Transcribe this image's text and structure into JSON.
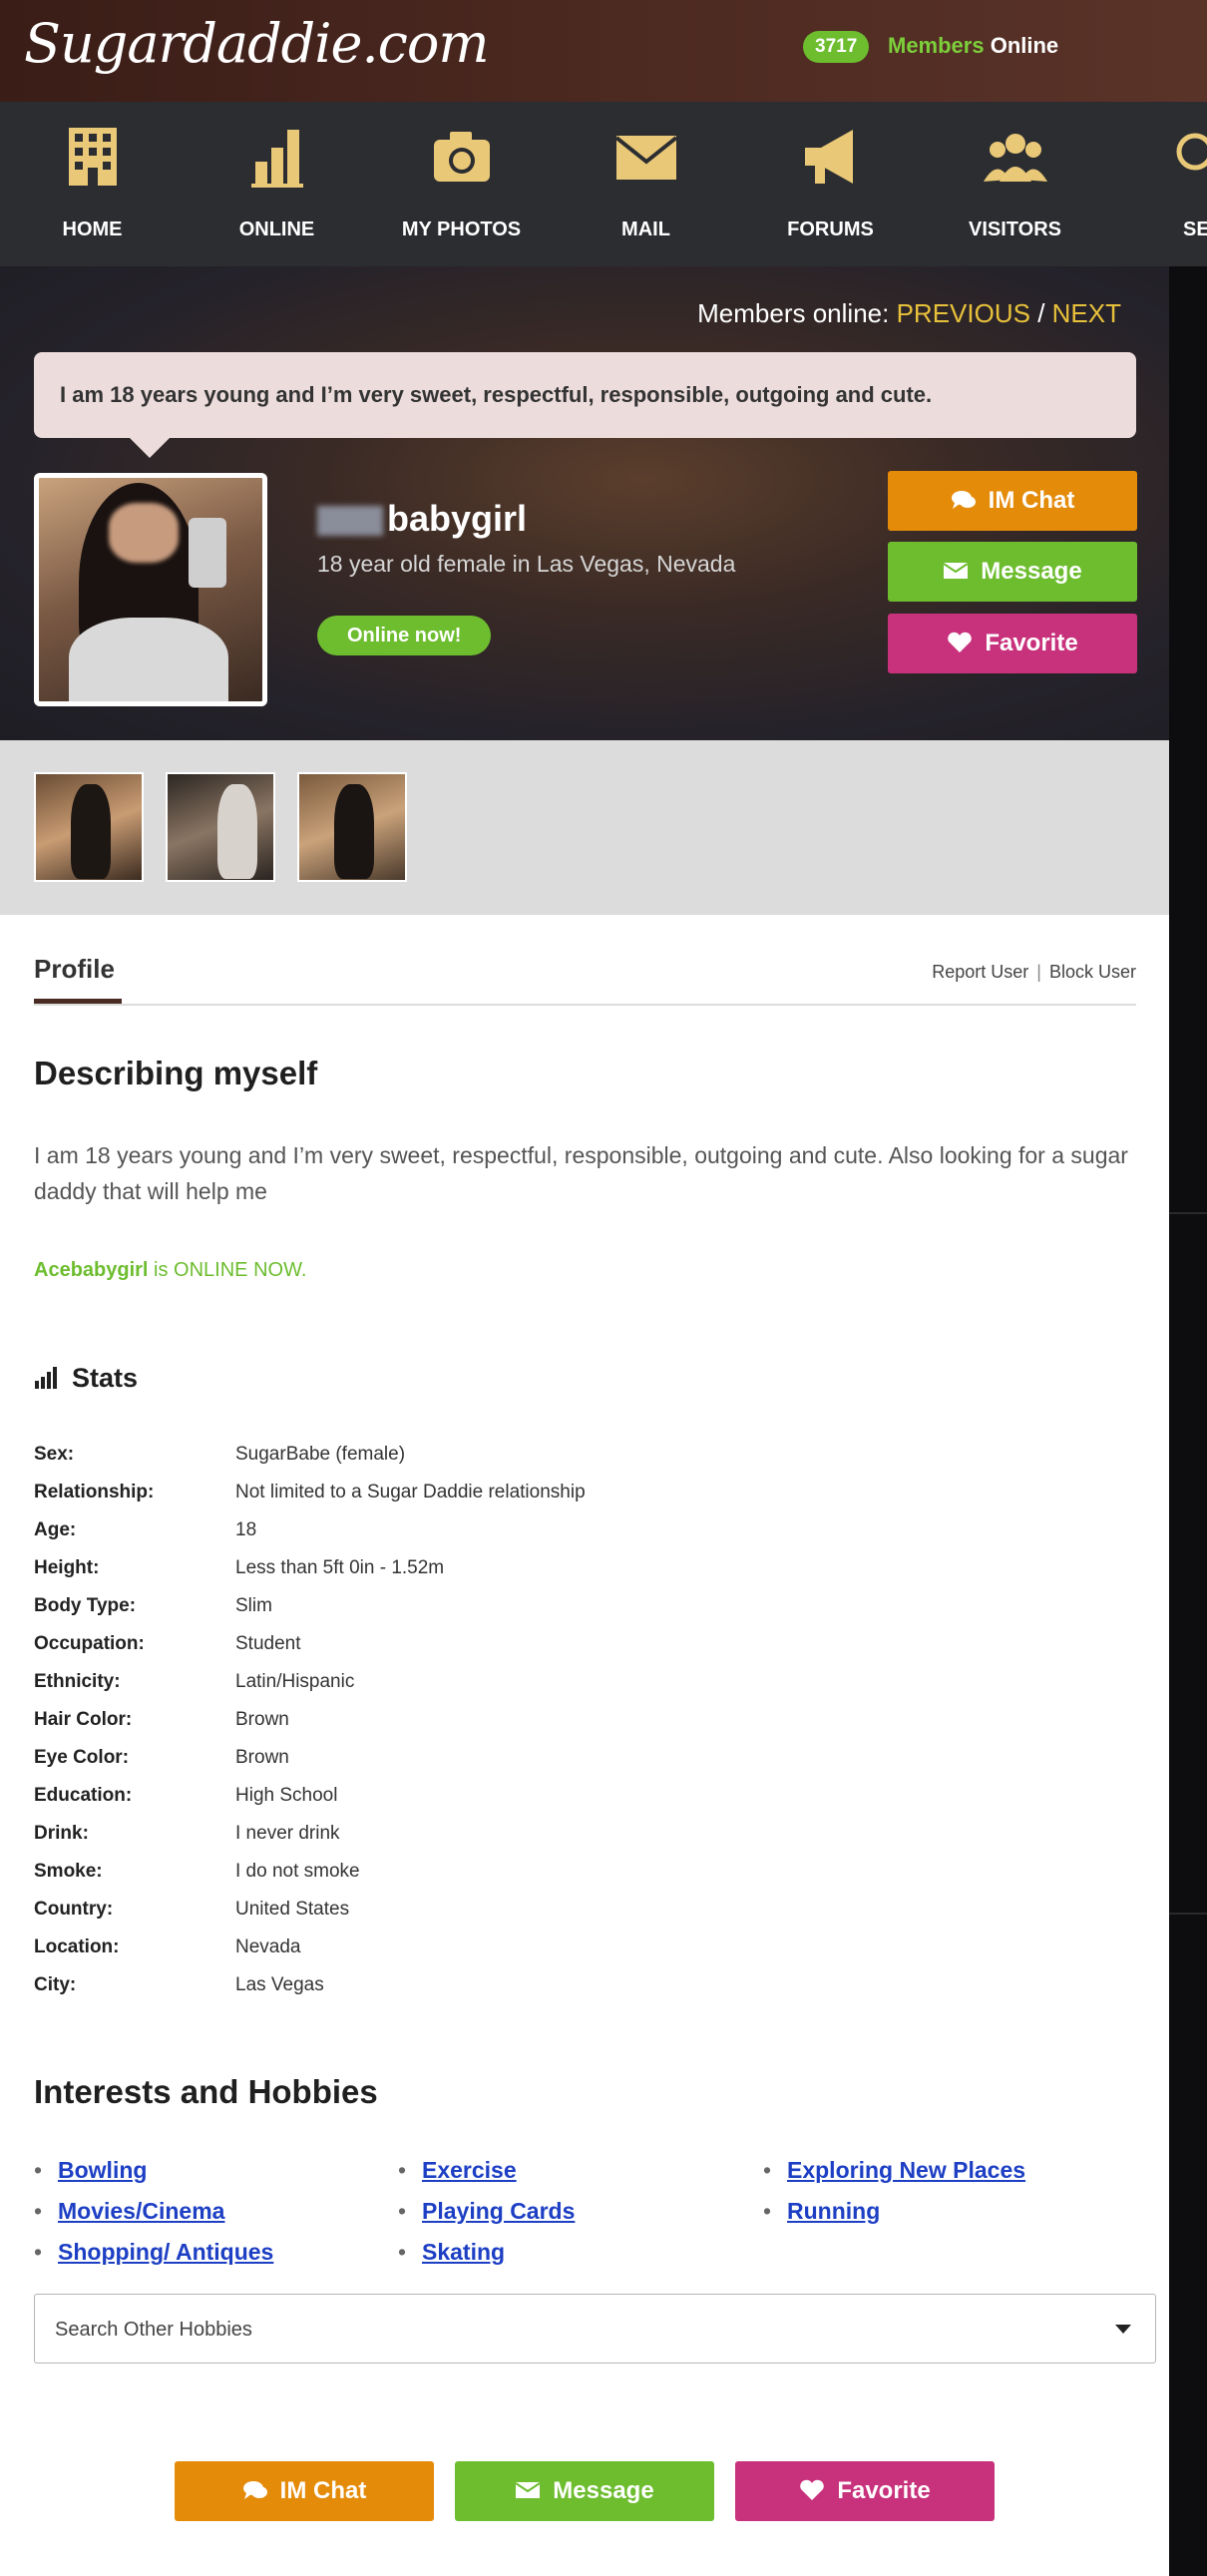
{
  "header": {
    "logo": "Sugardaddie.com",
    "members_online_count": "3717",
    "members_online_word1": "Members",
    "members_online_word2": "Online"
  },
  "nav": [
    {
      "label": "HOME",
      "icon": "building-icon"
    },
    {
      "label": "ONLINE",
      "icon": "bar-chart-icon"
    },
    {
      "label": "MY PHOTOS",
      "icon": "camera-icon"
    },
    {
      "label": "MAIL",
      "icon": "envelope-icon"
    },
    {
      "label": "FORUMS",
      "icon": "megaphone-icon"
    },
    {
      "label": "VISITORS",
      "icon": "group-icon"
    },
    {
      "label": "SEAR",
      "icon": "search-icon"
    }
  ],
  "hero": {
    "members_online_label": "Members online:",
    "previous": "PREVIOUS",
    "slash": "/",
    "next": "NEXT",
    "bubble_text": "I am 18 years young and I’m very sweet, respectful, responsible, outgoing and cute.",
    "username": "babygirl",
    "subtitle": "18 year old female in Las Vegas, Nevada",
    "online_now": "Online now!",
    "buttons": {
      "im_chat": "IM Chat",
      "message": "Message",
      "favorite": "Favorite"
    }
  },
  "profile": {
    "tab_label": "Profile",
    "report_user": "Report User",
    "separator": "|",
    "block_user": "Block User",
    "describing_title": "Describing myself",
    "describing_text": "I am 18 years young and I’m very sweet, respectful, responsible, outgoing and cute. Also looking for a sugar daddy that will help me",
    "online_name": "Acebabygirl",
    "online_suffix": "is ONLINE NOW.",
    "stats_title": "Stats",
    "stats": [
      {
        "label": "Sex:",
        "value": "SugarBabe (female)"
      },
      {
        "label": "Relationship:",
        "value": "Not limited to a Sugar Daddie relationship"
      },
      {
        "label": "Age:",
        "value": "18"
      },
      {
        "label": "Height:",
        "value": "Less than 5ft 0in - 1.52m"
      },
      {
        "label": "Body Type:",
        "value": "Slim"
      },
      {
        "label": "Occupation:",
        "value": "Student"
      },
      {
        "label": "Ethnicity:",
        "value": "Latin/Hispanic"
      },
      {
        "label": "Hair Color:",
        "value": "Brown"
      },
      {
        "label": "Eye Color:",
        "value": "Brown"
      },
      {
        "label": "Education:",
        "value": "High School"
      },
      {
        "label": "Drink:",
        "value": "I never drink"
      },
      {
        "label": "Smoke:",
        "value": "I do not smoke"
      },
      {
        "label": "Country:",
        "value": "United States"
      },
      {
        "label": "Location:",
        "value": "Nevada"
      },
      {
        "label": "City:",
        "value": "Las Vegas"
      }
    ],
    "interests_title": "Interests and Hobbies",
    "hobbies": [
      "Bowling",
      "Exercise",
      "Exploring New Places",
      "Movies/Cinema",
      "Playing Cards",
      "Running",
      "Shopping/ Antiques",
      "Skating"
    ],
    "search_hobbies_placeholder": "Search Other Hobbies"
  },
  "bottom_buttons": {
    "im_chat": "IM Chat",
    "message": "Message",
    "favorite": "Favorite"
  },
  "colors": {
    "green": "#6dbd2f",
    "orange": "#e58b0a",
    "pink": "#c8317b",
    "gold": "#e8c13b",
    "icon_gold": "#e9c877"
  }
}
